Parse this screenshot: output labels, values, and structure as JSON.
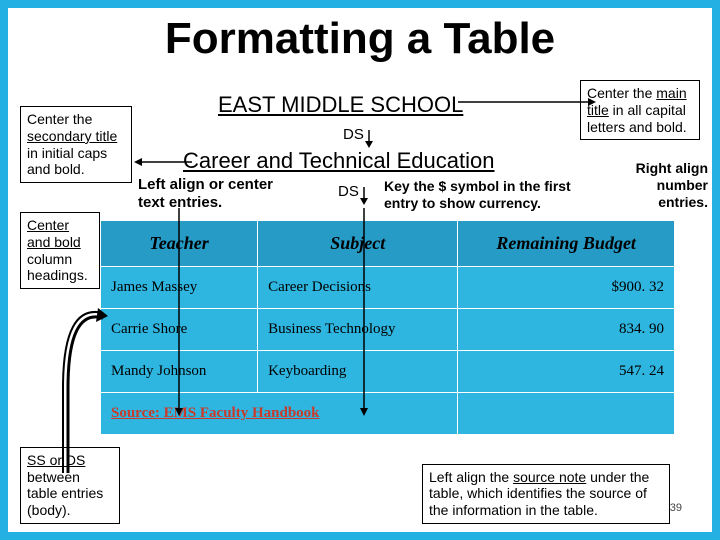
{
  "slideTitle": "Formatting a Table",
  "mainTitle": "EAST MIDDLE SCHOOL",
  "ds": "DS",
  "subTitle": "Career and Technical Education",
  "leftAlignNote": "Left align or center text entries.",
  "keyNote": "Key the $ symbol in the first entry to show currency.",
  "rightAlignNote": "Right align number entries.",
  "callouts": {
    "secondary": {
      "pre": "Center the ",
      "und": "secondary title",
      "post": " in initial caps and bold."
    },
    "colhead": {
      "pre": "",
      "und": "Center and bold",
      "post": " column headings."
    },
    "main": {
      "pre": "Center the ",
      "und": "main title",
      "post": " in all capital letters and bold."
    },
    "ssds": {
      "pre": "",
      "und": "SS or DS",
      "post": " between table entries (body)."
    },
    "source": {
      "pre": "Left align the ",
      "und": "source note",
      "post": " under the table, which identifies the source of the information in the table."
    }
  },
  "headers": {
    "c1": "Teacher",
    "c2": "Subject",
    "c3": "Remaining Budget"
  },
  "rows": [
    {
      "c1": "James Massey",
      "c2": "Career Decisions",
      "c3": "$900. 32"
    },
    {
      "c1": "Carrie Shore",
      "c2": "Business Technology",
      "c3": "834. 90"
    },
    {
      "c1": "Mandy Johnson",
      "c2": "Keyboarding",
      "c3": "547. 24"
    }
  ],
  "sourceLabel": "Source:",
  "sourceText": "EMS Faculty Handbook",
  "slideNum": "39"
}
